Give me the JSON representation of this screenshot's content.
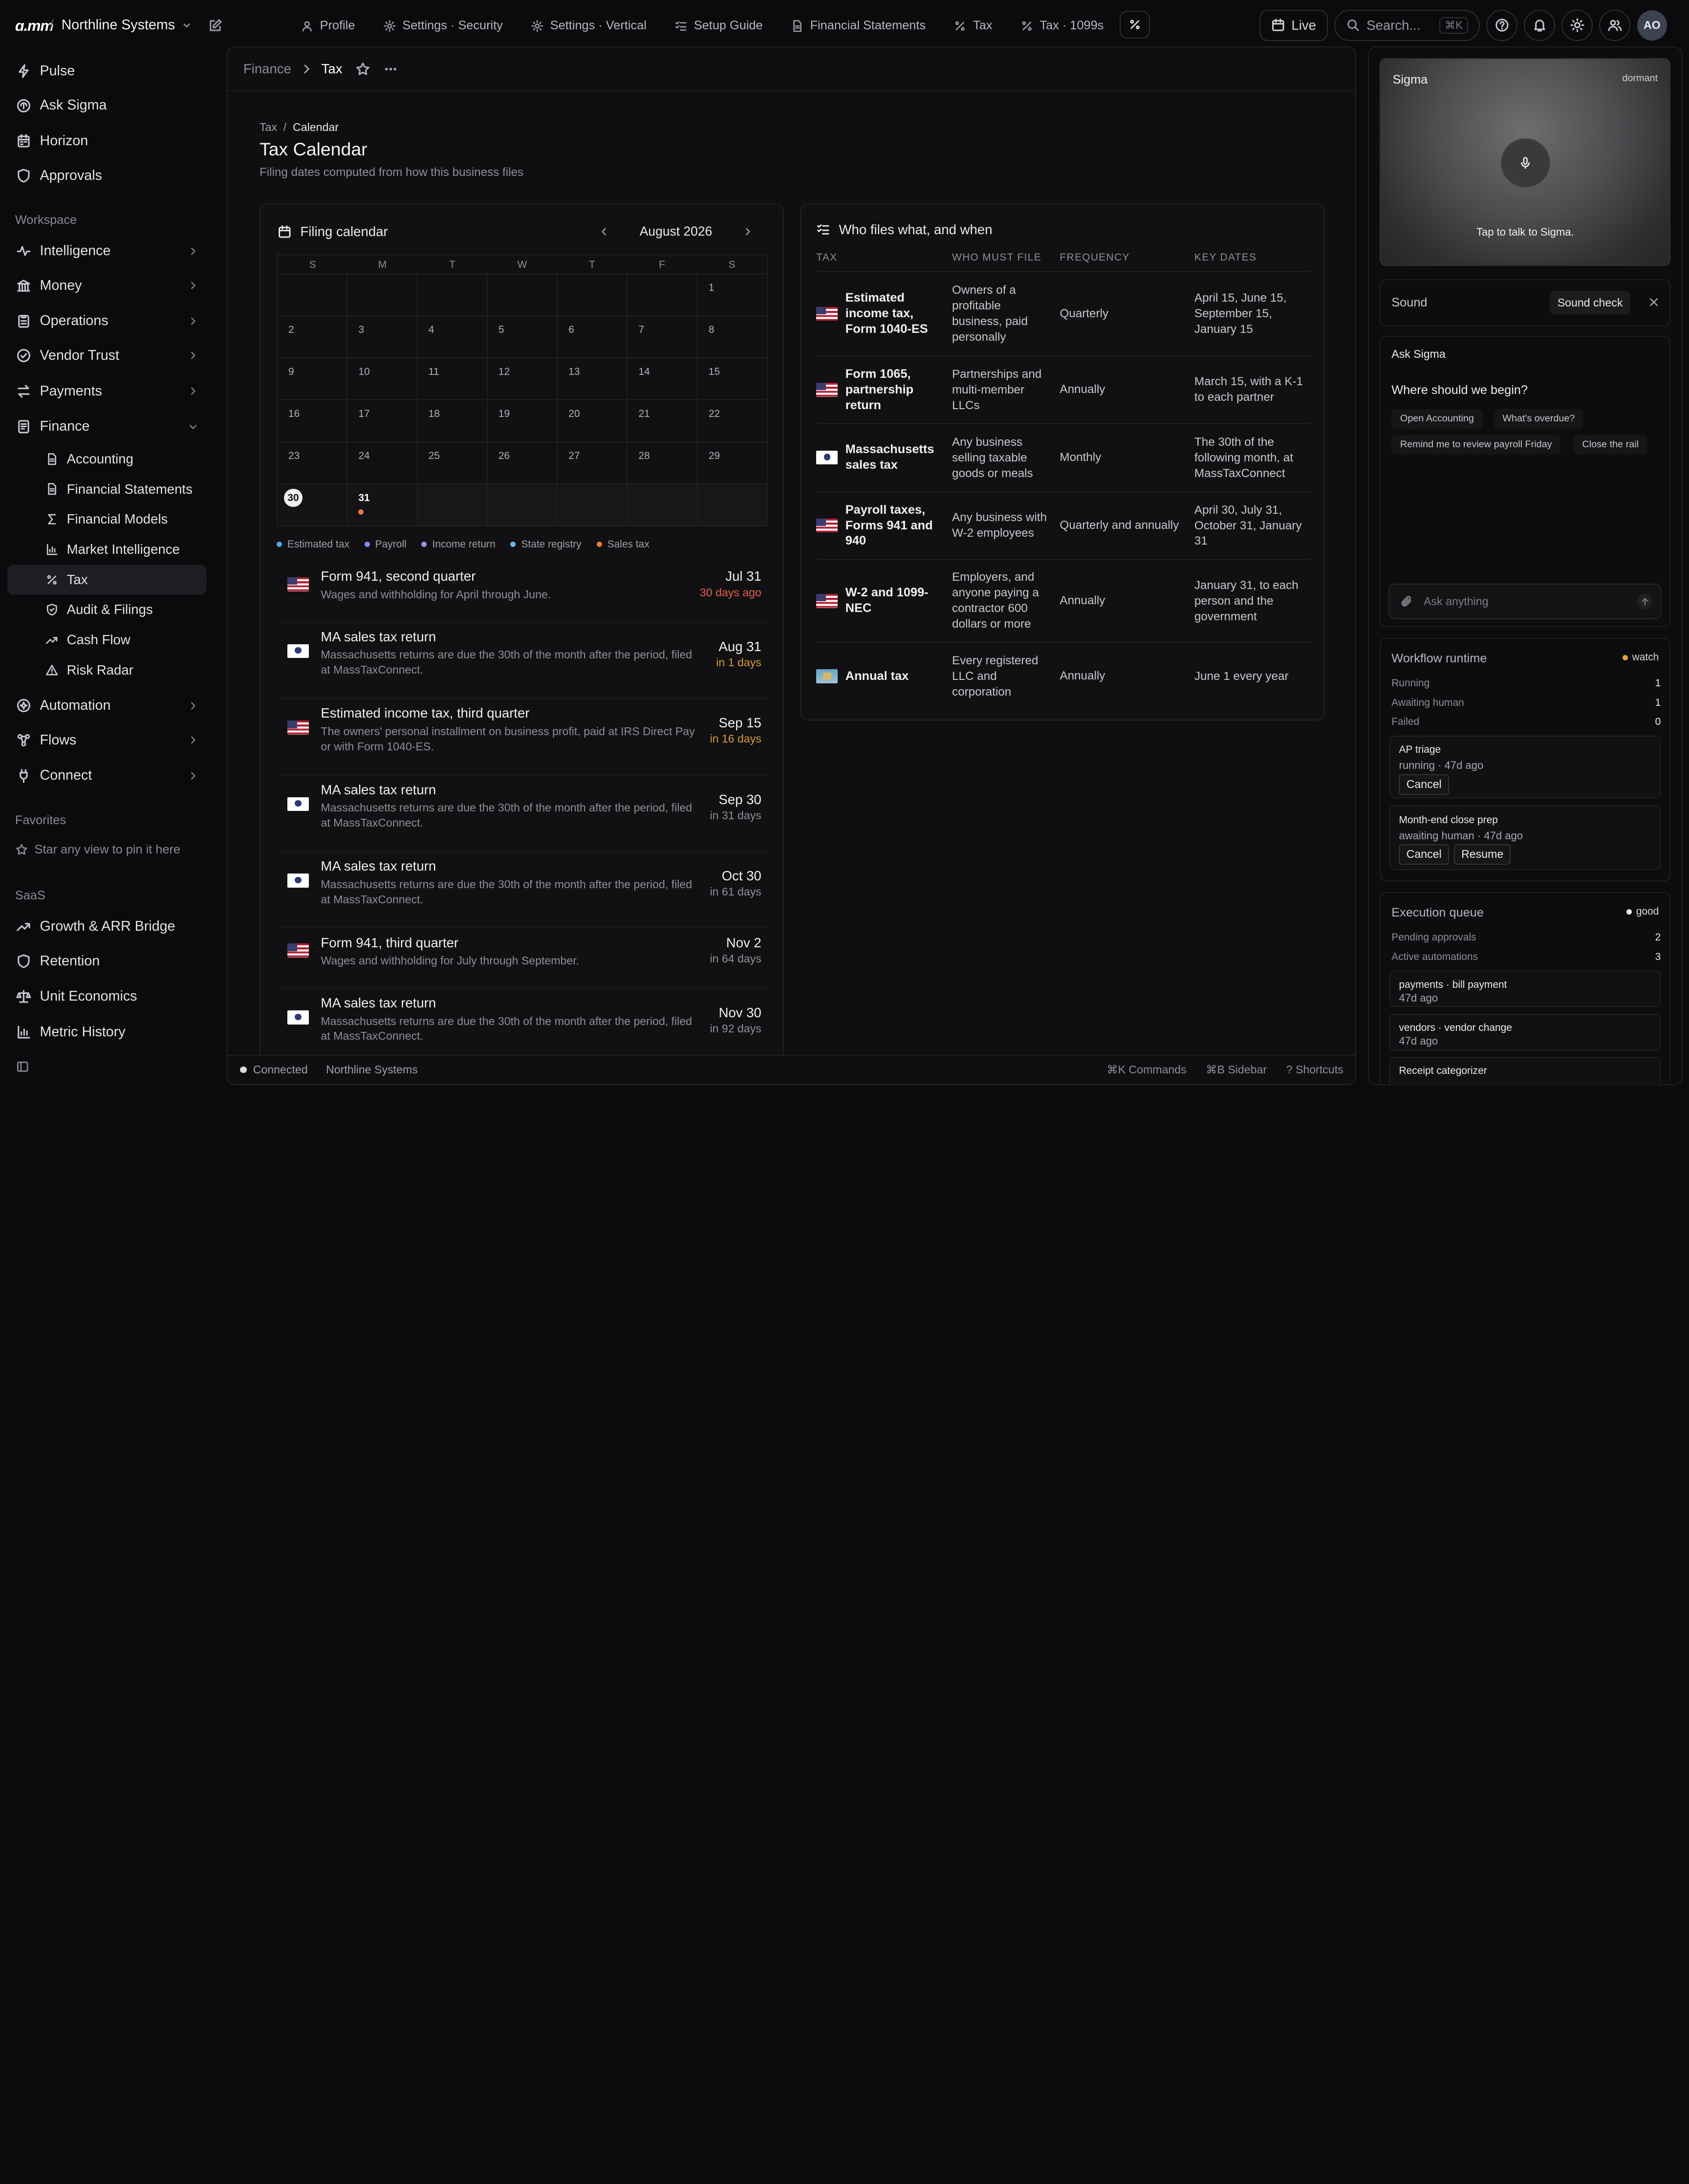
{
  "topbar": {
    "logo": "ɑ.тт",
    "org": "Northline Systems",
    "tabs": [
      {
        "label": "Profile",
        "icon": "user-icon"
      },
      {
        "label": "Settings · Security",
        "icon": "gear-icon"
      },
      {
        "label": "Settings · Vertical",
        "icon": "gear-icon"
      },
      {
        "label": "Setup Guide",
        "icon": "checklist-icon"
      },
      {
        "label": "Financial Statements",
        "icon": "document-icon"
      },
      {
        "label": "Tax",
        "icon": "percent-icon"
      },
      {
        "label": "Tax · 1099s",
        "icon": "percent-icon"
      }
    ],
    "live": "Live",
    "search_placeholder": "Search...",
    "search_kbd": "⌘K",
    "avatar": "AO"
  },
  "sidebar": {
    "top": [
      "Pulse",
      "Ask Sigma",
      "Horizon",
      "Approvals"
    ],
    "workspace_label": "Workspace",
    "groups": [
      "Intelligence",
      "Money",
      "Operations",
      "Vendor Trust",
      "Payments",
      "Finance"
    ],
    "finance_items": [
      "Accounting",
      "Financial Statements",
      "Financial Models",
      "Market Intelligence",
      "Tax",
      "Audit & Filings",
      "Cash Flow",
      "Risk Radar"
    ],
    "more": [
      "Automation",
      "Flows",
      "Connect"
    ],
    "favorites_label": "Favorites",
    "favorites_hint": "Star any view to pin it here",
    "saas_label": "SaaS",
    "saas_items": [
      "Growth & ARR Bridge",
      "Retention",
      "Unit Economics",
      "Metric History"
    ]
  },
  "main": {
    "crumb_parent": "Finance",
    "crumb_current": "Tax",
    "page_crumb_parent": "Tax",
    "page_crumb_current": "Calendar",
    "title": "Tax Calendar",
    "subtitle": "Filing dates computed from how this business files"
  },
  "calendar": {
    "heading": "Filing calendar",
    "month": "August 2026",
    "weekdays": [
      "S",
      "M",
      "T",
      "W",
      "T",
      "F",
      "S"
    ],
    "days": [
      "",
      "",
      "",
      "",
      "",
      "",
      "1",
      "2",
      "3",
      "4",
      "5",
      "6",
      "7",
      "8",
      "9",
      "10",
      "11",
      "12",
      "13",
      "14",
      "15",
      "16",
      "17",
      "18",
      "19",
      "20",
      "21",
      "22",
      "23",
      "24",
      "25",
      "26",
      "27",
      "28",
      "29",
      "30",
      "31"
    ],
    "legend": [
      {
        "label": "Estimated tax",
        "color": "#4ea4e0"
      },
      {
        "label": "Payroll",
        "color": "#7b8ce8"
      },
      {
        "label": "Income return",
        "color": "#a98be8"
      },
      {
        "label": "State registry",
        "color": "#6ab4e8"
      },
      {
        "label": "Sales tax",
        "color": "#e87a3a"
      }
    ]
  },
  "events": [
    {
      "flag": "us",
      "title": "Form 941, second quarter",
      "desc": "Wages and withholding for April through June.",
      "date": "Jul 31",
      "rel": "30 days ago",
      "tone": "red"
    },
    {
      "flag": "ma",
      "title": "MA sales tax return",
      "desc": "Massachusetts returns are due the 30th of the month after the period, filed at MassTaxConnect.",
      "date": "Aug 31",
      "rel": "in 1 days",
      "tone": "amb"
    },
    {
      "flag": "us",
      "title": "Estimated income tax, third quarter",
      "desc": "The owners' personal installment on business profit, paid at IRS Direct Pay or with Form 1040-ES.",
      "date": "Sep 15",
      "rel": "in 16 days",
      "tone": "amb"
    },
    {
      "flag": "ma",
      "title": "MA sales tax return",
      "desc": "Massachusetts returns are due the 30th of the month after the period, filed at MassTaxConnect.",
      "date": "Sep 30",
      "rel": "in 31 days",
      "tone": "gry"
    },
    {
      "flag": "ma",
      "title": "MA sales tax return",
      "desc": "Massachusetts returns are due the 30th of the month after the period, filed at MassTaxConnect.",
      "date": "Oct 30",
      "rel": "in 61 days",
      "tone": "gry"
    },
    {
      "flag": "us",
      "title": "Form 941, third quarter",
      "desc": "Wages and withholding for July through September.",
      "date": "Nov 2",
      "rel": "in 64 days",
      "tone": "gry"
    },
    {
      "flag": "ma",
      "title": "MA sales tax return",
      "desc": "Massachusetts returns are due the 30th of the month after the period, filed at MassTaxConnect.",
      "date": "Nov 30",
      "rel": "in 92 days",
      "tone": "gry"
    }
  ],
  "who": {
    "heading": "Who files what, and when",
    "columns": [
      "TAX",
      "WHO MUST FILE",
      "FREQUENCY",
      "KEY DATES"
    ],
    "rows": [
      {
        "flag": "us",
        "tax": "Estimated income tax, Form 1040-ES",
        "who": "Owners of a profitable business, paid personally",
        "freq": "Quarterly",
        "dates": "April 15, June 15, September 15, January 15"
      },
      {
        "flag": "us",
        "tax": "Form 1065, partnership return",
        "who": "Partnerships and multi-member LLCs",
        "freq": "Annually",
        "dates": "March 15, with a K-1 to each partner"
      },
      {
        "flag": "ma",
        "tax": "Massachusetts sales tax",
        "who": "Any business selling taxable goods or meals",
        "freq": "Monthly",
        "dates": "The 30th of the following month, at MassTaxConnect"
      },
      {
        "flag": "us",
        "tax": "Payroll taxes, Forms 941 and 940",
        "who": "Any business with W-2 employees",
        "freq": "Quarterly and annually",
        "dates": "April 30, July 31, October 31, January 31"
      },
      {
        "flag": "us",
        "tax": "W-2 and 1099-NEC",
        "who": "Employers, and anyone paying a contractor 600 dollars or more",
        "freq": "Annually",
        "dates": "January 31, to each person and the government"
      },
      {
        "flag": "de",
        "tax": "Annual tax",
        "who": "Every registered LLC and corporation",
        "freq": "Annually",
        "dates": "June 1 every year"
      }
    ]
  },
  "status": {
    "connection": "Connected",
    "org": "Northline Systems",
    "commands": "⌘K Commands",
    "sidebar": "⌘B Sidebar",
    "shortcuts": "? Shortcuts"
  },
  "rail": {
    "sigma_name": "Sigma",
    "sigma_state": "dormant",
    "sigma_tap": "Tap to talk to Sigma.",
    "sound_label": "Sound",
    "sound_check": "Sound check",
    "ask_heading": "Ask Sigma",
    "ask_question": "Where should we begin?",
    "chips": [
      "Open Accounting",
      "What's overdue?",
      "Remind me to review payroll Friday",
      "Close the rail"
    ],
    "ask_placeholder": "Ask anything",
    "workflow": {
      "title": "Workflow runtime",
      "badge": "watch",
      "badge_color": "#e5a53a",
      "stats": [
        {
          "k": "Running",
          "v": "1"
        },
        {
          "k": "Awaiting human",
          "v": "1"
        },
        {
          "k": "Failed",
          "v": "0"
        }
      ],
      "jobs": [
        {
          "name": "AP triage",
          "status": "running · 47d ago",
          "buttons": [
            "Cancel"
          ]
        },
        {
          "name": "Month-end close prep",
          "status": "awaiting human · 47d ago",
          "buttons": [
            "Cancel",
            "Resume"
          ]
        }
      ]
    },
    "queue": {
      "title": "Execution queue",
      "badge": "good",
      "badge_color": "#e8e8e8",
      "stats": [
        {
          "k": "Pending approvals",
          "v": "2"
        },
        {
          "k": "Active automations",
          "v": "3"
        }
      ],
      "items": [
        {
          "name": "payments · bill payment",
          "age": "47d ago"
        },
        {
          "name": "vendors · vendor change",
          "age": "47d ago"
        },
        {
          "name": "Receipt categorizer",
          "age": ""
        }
      ]
    }
  }
}
